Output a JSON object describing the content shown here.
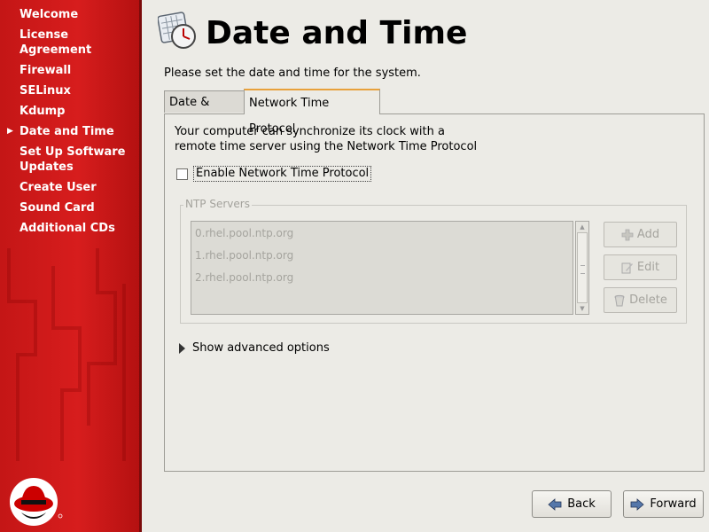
{
  "sidebar": {
    "items": [
      {
        "label": "Welcome"
      },
      {
        "label": "License Agreement"
      },
      {
        "label": "Firewall"
      },
      {
        "label": "SELinux"
      },
      {
        "label": "Kdump"
      },
      {
        "label": "Date and Time",
        "current": true
      },
      {
        "label": "Set Up Software Updates"
      },
      {
        "label": "Create User"
      },
      {
        "label": "Sound Card"
      },
      {
        "label": "Additional CDs"
      }
    ]
  },
  "header": {
    "title": "Date and Time",
    "subtitle": "Please set the date and time for the system."
  },
  "tabs": [
    {
      "label": "Date & Time",
      "active": false
    },
    {
      "label": "Network Time Protocol",
      "active": true
    }
  ],
  "ntp": {
    "description_line1": "Your computer can synchronize its clock with a",
    "description_line2": "remote time server using the Network Time Protocol",
    "enable_label": "Enable Network Time Protocol",
    "enable_checked": false,
    "servers_frame_label": "NTP Servers",
    "servers": [
      "0.rhel.pool.ntp.org",
      "1.rhel.pool.ntp.org",
      "2.rhel.pool.ntp.org"
    ],
    "add_label": "Add",
    "edit_label": "Edit",
    "delete_label": "Delete",
    "advanced_label": "Show advanced options"
  },
  "nav": {
    "back_label": "Back",
    "forward_label": "Forward"
  },
  "colors": {
    "sidebar_red": "#cc1818",
    "active_tab_accent": "#e8a13c"
  }
}
